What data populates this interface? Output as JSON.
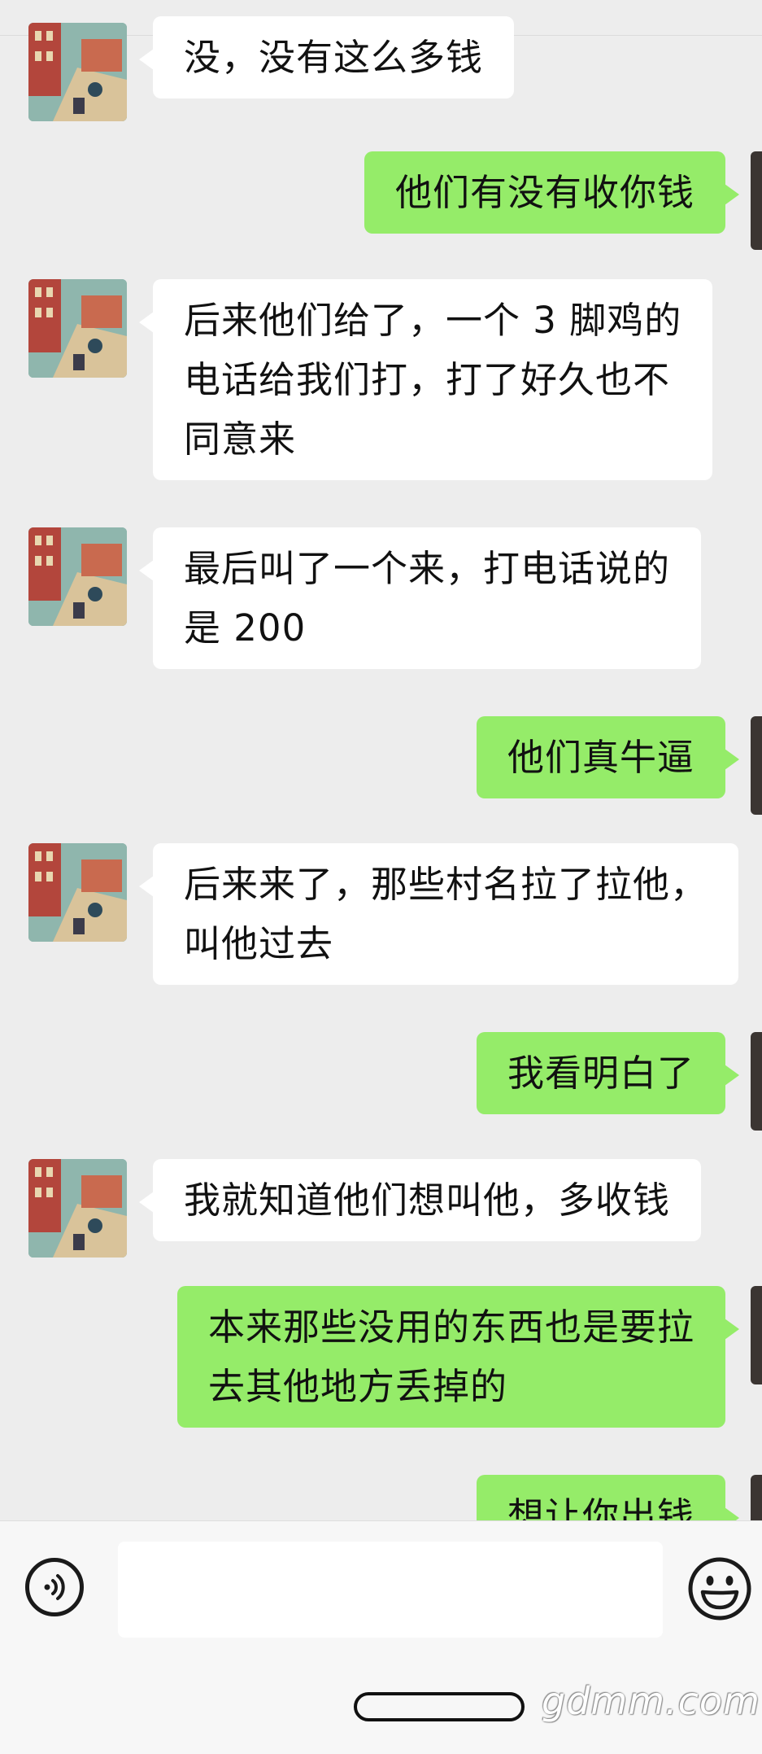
{
  "messages": [
    {
      "side": "in",
      "text": "没，没有这么多钱"
    },
    {
      "side": "out",
      "text": "他们有没有收你钱"
    },
    {
      "side": "in",
      "text": "后来他们给了，一个 3 脚鸡的\n电话给我们打，打了好久也不\n同意来"
    },
    {
      "side": "in",
      "text": "最后叫了一个来，打电话说的\n是 200"
    },
    {
      "side": "out",
      "text": "他们真牛逼"
    },
    {
      "side": "in",
      "text": "后来来了，那些村名拉了拉他，\n叫他过去"
    },
    {
      "side": "out",
      "text": "我看明白了"
    },
    {
      "side": "in",
      "text": "我就知道他们想叫他，多收钱"
    },
    {
      "side": "out",
      "text": "本来那些没用的东西也是要拉\n去其他地方丢掉的"
    },
    {
      "side": "out",
      "text": "想让你出钱"
    }
  ],
  "input_bar": {
    "voice_icon": "voice-icon",
    "input_value": "",
    "emoji_icon": "emoji-icon"
  },
  "watermark": "gdmm.com",
  "colors": {
    "background": "#ededed",
    "incoming_bubble": "#ffffff",
    "outgoing_bubble": "#95ec69"
  }
}
